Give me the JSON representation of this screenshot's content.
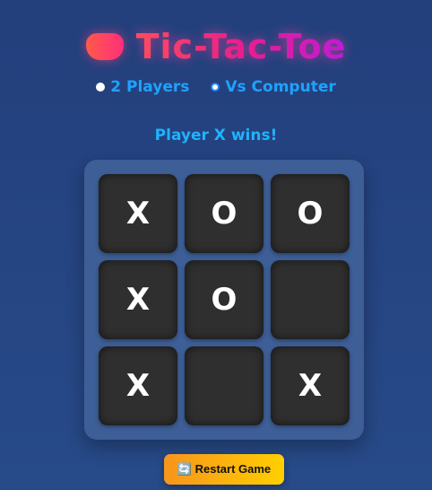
{
  "header": {
    "title": "Tic-Tac-Toe",
    "icon": "gamepad-icon"
  },
  "modes": [
    {
      "label": "2 Players",
      "selected": false
    },
    {
      "label": "Vs Computer",
      "selected": true
    }
  ],
  "status": "Player X wins!",
  "board": [
    "X",
    "O",
    "O",
    "X",
    "O",
    "",
    "X",
    "",
    "X"
  ],
  "restart": {
    "icon": "🔄",
    "label": "Restart Game"
  },
  "colors": {
    "accent": "#1ea2ff",
    "board": "#3d5e96",
    "cell": "#2f2f2f"
  }
}
